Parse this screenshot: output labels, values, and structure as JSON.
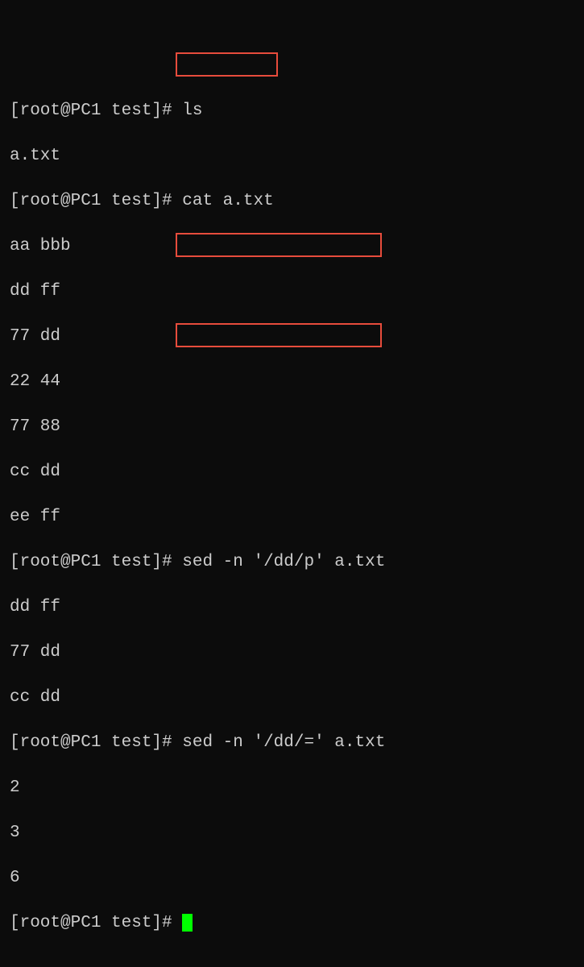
{
  "prompt": "[root@PC1 test]# ",
  "lines": {
    "cmd1": "ls",
    "out1": "a.txt",
    "cmd2": "cat a.txt",
    "cat_out": [
      "aa bbb",
      "dd ff",
      "77 dd",
      "22 44",
      "77 88",
      "cc dd",
      "ee ff"
    ],
    "cmd3": "sed -n '/dd/p' a.txt",
    "sed_p_out": [
      "dd ff",
      "77 dd",
      "cc dd"
    ],
    "cmd4": "sed -n '/dd/=' a.txt",
    "sed_eq_out": [
      "2",
      "3",
      "6"
    ]
  }
}
